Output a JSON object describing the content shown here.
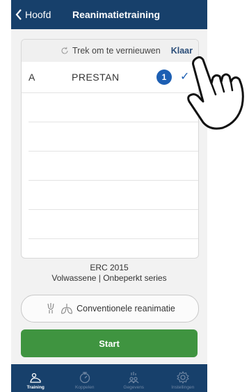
{
  "navbar": {
    "back_label": "Hoofd",
    "title": "Reanimatietraining"
  },
  "list": {
    "refresh_label": "Trek om te vernieuwen",
    "done_label": "Klaar",
    "device": {
      "letter": "A",
      "name": "PRESTAN",
      "badge": "1",
      "check": "✓"
    }
  },
  "info": {
    "line1": "ERC 2015",
    "line2": "Volwassene | Onbeperkt series"
  },
  "mode_button": {
    "label": "Conventionele reanimatie"
  },
  "start_button": {
    "label": "Start"
  },
  "tabs": [
    {
      "label": "Training",
      "icon": "training-icon",
      "active": true
    },
    {
      "label": "Koppelen",
      "icon": "connect-icon",
      "active": false
    },
    {
      "label": "Gegevens",
      "icon": "data-icon",
      "active": false
    },
    {
      "label": "Instellingen",
      "icon": "settings-icon",
      "active": false
    }
  ],
  "colors": {
    "navbar": "#17406b",
    "accent": "#1d5fb3",
    "start": "#3f9440"
  }
}
